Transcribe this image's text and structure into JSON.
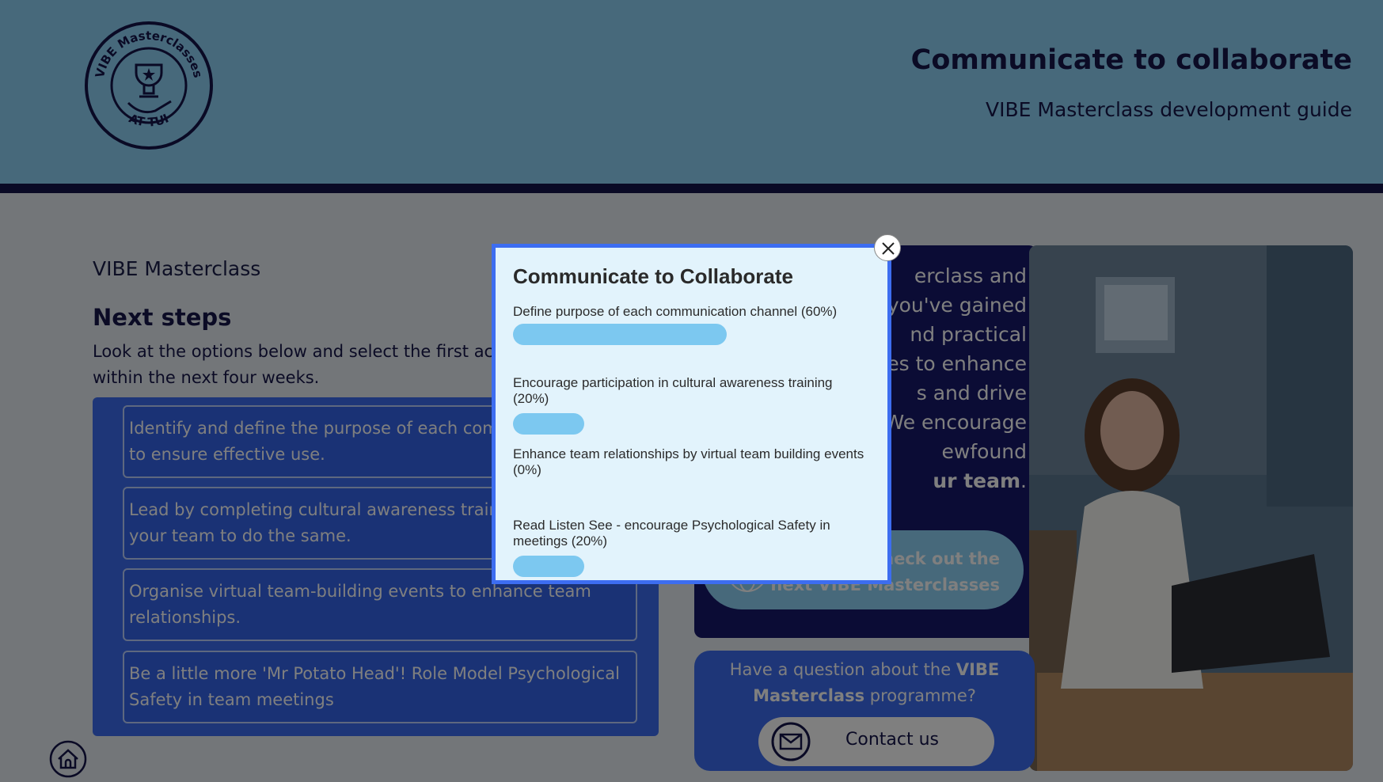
{
  "header": {
    "title": "Communicate to collaborate",
    "subtitle": "VIBE Masterclass development guide",
    "logo_text_top": "VIBE Masterclasses",
    "logo_text_bottom": "AT TUI"
  },
  "main": {
    "section_label": "VIBE Masterclass",
    "next_steps_title": "Next steps",
    "next_steps_body": "Look at the options below and select the first act",
    "next_steps_body_line2": "within the next four weeks.",
    "options": [
      {
        "line1": "Identify and define the purpose of each commu",
        "line2": "to ensure effective use."
      },
      {
        "line1": "Lead by completing cultural awareness training a",
        "line2": "your team to do the same."
      },
      {
        "line1": "Organise virtual team-building events to enhance team",
        "line2": "relationships."
      },
      {
        "line1": "Be a little more 'Mr Potato Head'! Role Model Psychological",
        "line2": "Safety in team meetings"
      }
    ]
  },
  "intro_panel": {
    "lines": [
      "erclass and",
      "t you've gained",
      "nd practical",
      "ties to enhance",
      "s and drive",
      "We encourage",
      "ewfound"
    ],
    "last_line_bold": "ur team",
    "last_line_end": ".",
    "cta_line1": "check out the",
    "cta_line2": "next VIBE Masterclasses"
  },
  "contact": {
    "question_prefix": "Have a question about the ",
    "question_bold1": "VIBE",
    "question_bold2": "Masterclass",
    "question_suffix": " programme?",
    "button_label": "Contact us"
  },
  "modal": {
    "title": "Communicate to Collaborate",
    "items": [
      {
        "label": "Define purpose of each communication channel (60%)",
        "percent": 60
      },
      {
        "label": "Encourage participation in cultural awareness training (20%)",
        "percent": 20
      },
      {
        "label": "Enhance team relationships by virtual team building events (0%)",
        "percent": 0
      },
      {
        "label": "Read Listen See - encourage Psychological Safety in meetings (20%)",
        "percent": 20
      }
    ]
  },
  "icons": {
    "logo": "trophy-hand-badge-icon",
    "close": "close-icon",
    "globe": "globe-icon",
    "mail": "mail-icon",
    "home": "home-icon"
  },
  "colors": {
    "header_bg": "#8fd3f7",
    "navy": "#16174a",
    "primary_blue": "#3d6df0",
    "dark_panel": "#17196b",
    "poll_bar": "#7cc8f0",
    "modal_bg": "#e2f3fc"
  }
}
